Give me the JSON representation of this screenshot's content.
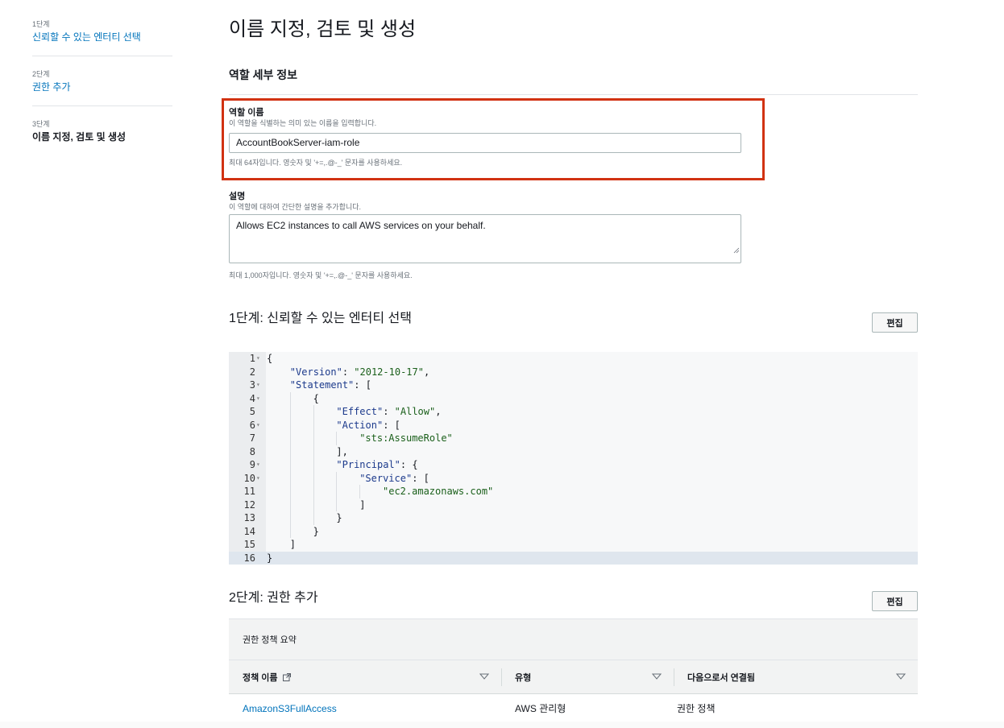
{
  "sidebar": {
    "steps": [
      {
        "number": "1단계",
        "label": "신뢰할 수 있는 엔터티 선택"
      },
      {
        "number": "2단계",
        "label": "권한 추가"
      },
      {
        "number": "3단계",
        "label": "이름 지정, 검토 및 생성"
      }
    ]
  },
  "page": {
    "title": "이름 지정, 검토 및 생성",
    "section_title": "역할 세부 정보"
  },
  "role_name": {
    "label": "역할 이름",
    "description": "이 역할을 식별하는 의미 있는 이름을 입력합니다.",
    "value": "AccountBookServer-iam-role",
    "hint": "최대 64자입니다. 영숫자 및 '+=,.@-_' 문자를 사용하세요."
  },
  "role_description": {
    "label": "설명",
    "description": "이 역할에 대하여 간단한 설명을 추가합니다.",
    "value": "Allows EC2 instances to call AWS services on your behalf.",
    "hint": "최대 1,000자입니다. 영숫자 및 '+=,.@-_' 문자를 사용하세요."
  },
  "step1": {
    "title": "1단계: 신뢰할 수 있는 엔터티 선택",
    "edit_label": "편집",
    "code_lines": [
      {
        "n": "1",
        "fold": true,
        "indent": 0,
        "tokens": [
          [
            "p",
            "{"
          ]
        ]
      },
      {
        "n": "2",
        "fold": false,
        "indent": 1,
        "tokens": [
          [
            "k",
            "\"Version\""
          ],
          [
            "p",
            ": "
          ],
          [
            "s",
            "\"2012-10-17\""
          ],
          [
            "p",
            ","
          ]
        ]
      },
      {
        "n": "3",
        "fold": true,
        "indent": 1,
        "tokens": [
          [
            "k",
            "\"Statement\""
          ],
          [
            "p",
            ": ["
          ]
        ]
      },
      {
        "n": "4",
        "fold": true,
        "indent": 2,
        "tokens": [
          [
            "p",
            "{"
          ]
        ]
      },
      {
        "n": "5",
        "fold": false,
        "indent": 3,
        "tokens": [
          [
            "k",
            "\"Effect\""
          ],
          [
            "p",
            ": "
          ],
          [
            "s",
            "\"Allow\""
          ],
          [
            "p",
            ","
          ]
        ]
      },
      {
        "n": "6",
        "fold": true,
        "indent": 3,
        "tokens": [
          [
            "k",
            "\"Action\""
          ],
          [
            "p",
            ": ["
          ]
        ]
      },
      {
        "n": "7",
        "fold": false,
        "indent": 4,
        "tokens": [
          [
            "s",
            "\"sts:AssumeRole\""
          ]
        ]
      },
      {
        "n": "8",
        "fold": false,
        "indent": 3,
        "tokens": [
          [
            "p",
            "],"
          ]
        ]
      },
      {
        "n": "9",
        "fold": true,
        "indent": 3,
        "tokens": [
          [
            "k",
            "\"Principal\""
          ],
          [
            "p",
            ": {"
          ]
        ]
      },
      {
        "n": "10",
        "fold": true,
        "indent": 4,
        "tokens": [
          [
            "k",
            "\"Service\""
          ],
          [
            "p",
            ": ["
          ]
        ]
      },
      {
        "n": "11",
        "fold": false,
        "indent": 5,
        "tokens": [
          [
            "s",
            "\"ec2.amazonaws.com\""
          ]
        ]
      },
      {
        "n": "12",
        "fold": false,
        "indent": 4,
        "tokens": [
          [
            "p",
            "]"
          ]
        ]
      },
      {
        "n": "13",
        "fold": false,
        "indent": 3,
        "tokens": [
          [
            "p",
            "}"
          ]
        ]
      },
      {
        "n": "14",
        "fold": false,
        "indent": 2,
        "tokens": [
          [
            "p",
            "}"
          ]
        ]
      },
      {
        "n": "15",
        "fold": false,
        "indent": 1,
        "tokens": [
          [
            "p",
            "]"
          ]
        ]
      },
      {
        "n": "16",
        "fold": false,
        "indent": 0,
        "tokens": [
          [
            "p",
            "}"
          ]
        ]
      }
    ]
  },
  "step2": {
    "title": "2단계: 권한 추가",
    "edit_label": "편집",
    "panel_title": "권한 정책 요약",
    "columns": [
      "정책 이름",
      "유형",
      "다음으로서 연결됨"
    ],
    "rows": [
      {
        "name": "AmazonS3FullAccess",
        "type": "AWS 관리형",
        "attached_as": "권한 정책"
      }
    ]
  },
  "colors": {
    "link": "#0073bb",
    "highlight_border": "#d13212",
    "active_line": "#dfe6ee"
  }
}
